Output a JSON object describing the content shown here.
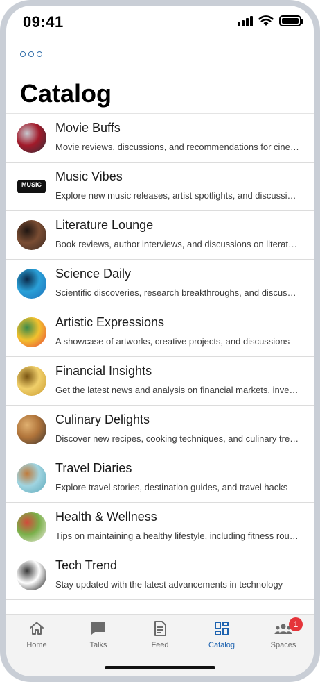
{
  "status_bar": {
    "time": "09:41"
  },
  "header": {
    "title": "Catalog",
    "more_icon": "more-horizontal-icon"
  },
  "catalog": [
    {
      "title": "Movie Buffs",
      "description": "Movie reviews, discussions, and recommendations for cinema lovers",
      "avatar_colors": [
        "#2a2f3a",
        "#a21a2a",
        "#c7c9d0"
      ]
    },
    {
      "title": "Music Vibes",
      "description": "Explore new music releases, artist spotlights, and discussions",
      "avatar_colors": [
        "#ffffff",
        "#111111",
        "#444444"
      ],
      "avatar_text": "MUSIC"
    },
    {
      "title": "Literature Lounge",
      "description": "Book reviews, author interviews, and discussions on literature",
      "avatar_colors": [
        "#3c2a22",
        "#7a4d33",
        "#1f1612"
      ]
    },
    {
      "title": "Science Daily",
      "description": "Scientific discoveries, research breakthroughs, and discussions",
      "avatar_colors": [
        "#1e6fb8",
        "#2aa0d8",
        "#0b2a4a"
      ]
    },
    {
      "title": "Artistic Expressions",
      "description": "A showcase of artworks, creative projects, and discussions",
      "avatar_colors": [
        "#e8433a",
        "#f2c12e",
        "#3a8a4a"
      ]
    },
    {
      "title": "Financial Insights",
      "description": "Get the latest news and analysis on financial markets, investing",
      "avatar_colors": [
        "#c99a2e",
        "#f0cf6a",
        "#7a5512"
      ]
    },
    {
      "title": "Culinary Delights",
      "description": "Discover new recipes, cooking techniques, and culinary trends",
      "avatar_colors": [
        "#3a3430",
        "#b0743a",
        "#e0b070"
      ]
    },
    {
      "title": "Travel Diaries",
      "description": "Explore travel stories, destination guides, and travel hacks",
      "avatar_colors": [
        "#5aa6b8",
        "#a0d4e0",
        "#c07a3a"
      ]
    },
    {
      "title": "Health & Wellness",
      "description": "Tips on maintaining a healthy lifestyle, including fitness routines",
      "avatar_colors": [
        "#f4efe6",
        "#7ab04a",
        "#d24a3a"
      ]
    },
    {
      "title": "Tech Trend",
      "description": "Stay updated with the latest advancements in technology",
      "avatar_colors": [
        "#0d0d0d",
        "#ffffff",
        "#3a3a3a"
      ]
    }
  ],
  "tabs": [
    {
      "label": "Home",
      "icon": "home-icon",
      "active": false
    },
    {
      "label": "Talks",
      "icon": "chat-bubble-icon",
      "active": false
    },
    {
      "label": "Feed",
      "icon": "document-icon",
      "active": false
    },
    {
      "label": "Catalog",
      "icon": "grid-icon",
      "active": true
    },
    {
      "label": "Spaces",
      "icon": "people-icon",
      "active": false,
      "badge": "1"
    }
  ],
  "colors": {
    "accent": "#1e63b0",
    "badge": "#e5343a",
    "inactive": "#6b6b6b"
  }
}
